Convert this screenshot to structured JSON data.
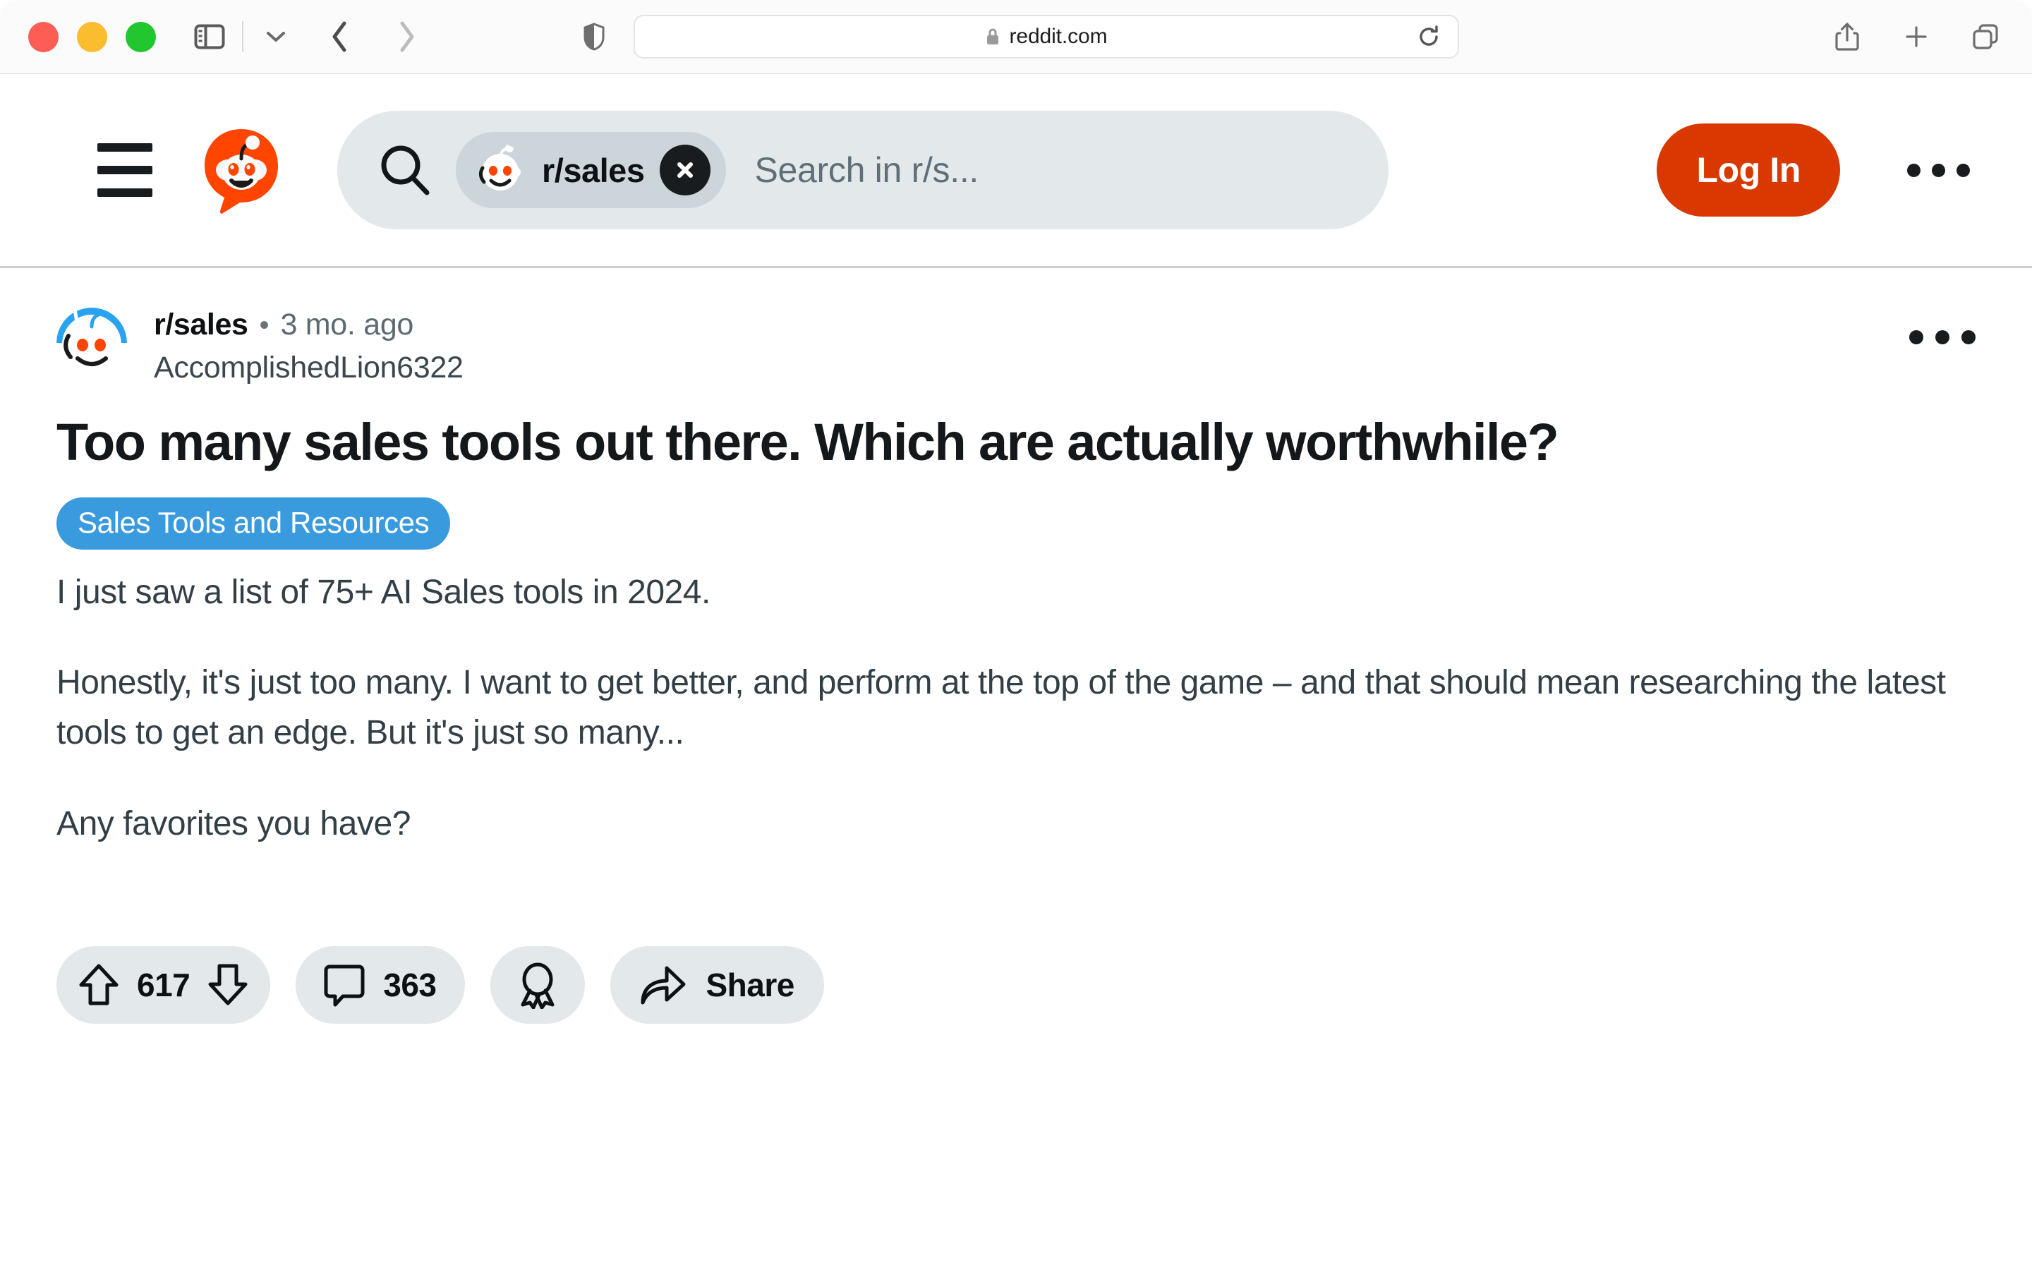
{
  "browser": {
    "traffic_lights": [
      "close",
      "minimize",
      "maximize"
    ],
    "url": "reddit.com",
    "secure": true,
    "icons": {
      "sidebar": "sidebar-icon",
      "chevron_down": "chevron-down-icon",
      "back": "back-arrow-icon",
      "forward": "forward-arrow-icon",
      "shield": "shield-icon",
      "lock": "lock-icon",
      "reload": "reload-icon",
      "share": "share-icon",
      "new_tab": "plus-icon",
      "tab_overview": "tab-overview-icon"
    }
  },
  "header": {
    "menu_label": "menu",
    "logo_label": "reddit-logo",
    "search": {
      "chip_label": "r/sales",
      "placeholder": "Search in r/s...",
      "clear_label": "clear"
    },
    "login_label": "Log In",
    "more_label": "more"
  },
  "post": {
    "subreddit": "r/sales",
    "separator": "•",
    "timestamp": "3 mo. ago",
    "author": "AccomplishedLion6322",
    "title": "Too many sales tools out there. Which are actually worthwhile?",
    "flair": "Sales Tools and Resources",
    "body": [
      "I just saw a list of 75+ AI Sales tools in 2024.",
      "Honestly, it's just too many. I want to get better, and perform at the top of the game – and that should mean researching the latest tools to get an edge. But it's just so many...",
      "Any favorites you have?"
    ],
    "actions": {
      "upvote_label": "upvote",
      "score": "617",
      "downvote_label": "downvote",
      "comments": "363",
      "award_label": "award",
      "share_label": "Share"
    }
  },
  "colors": {
    "reddit_orange": "#d93900",
    "flair_blue": "#3a9ade",
    "pill_gray": "#e3e8ea",
    "chip_gray": "#ccd5da",
    "text_dark": "#0e1113",
    "text_body": "#333f46",
    "text_muted": "#5c6a72"
  }
}
